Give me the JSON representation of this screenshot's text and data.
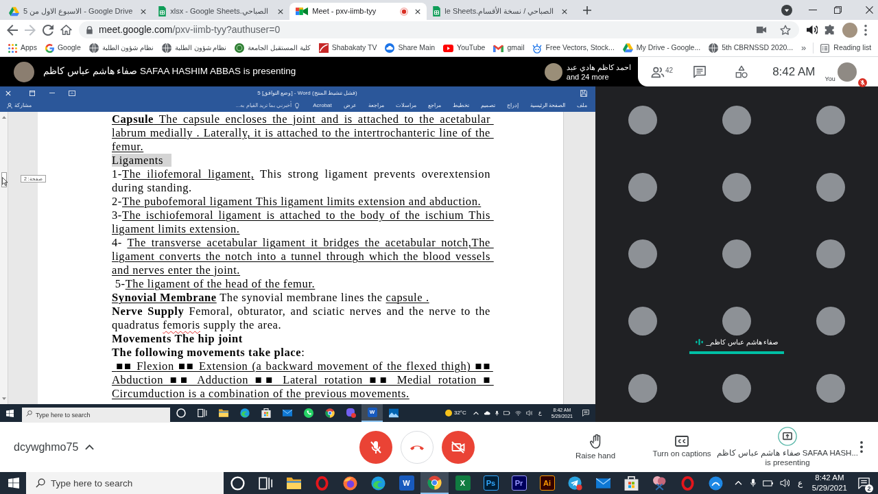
{
  "browser": {
    "tabs": [
      {
        "kind": "drive",
        "title": "5 الاسبوع الاول من - Google Drive",
        "selected": false,
        "recording": false
      },
      {
        "kind": "sheets",
        "title": "xlsx - Google Sheets.الصباحي",
        "selected": false,
        "recording": false
      },
      {
        "kind": "meet",
        "title": "Meet - pxv-iimb-tyy",
        "selected": true,
        "recording": true
      },
      {
        "kind": "sheets",
        "title": "le Sheets.الصباحي / نسخة الأقسام",
        "selected": false,
        "recording": false
      }
    ],
    "address": {
      "host": "meet.google.com",
      "path": "/pxv-iimb-tyy?authuser=0"
    },
    "bookmarks": [
      {
        "kind": "apps",
        "label": "Apps"
      },
      {
        "kind": "google",
        "label": "Google"
      },
      {
        "kind": "globe",
        "label": "نظام شؤون الطلبة"
      },
      {
        "kind": "globe",
        "label": "نظام شؤون الطلبة"
      },
      {
        "kind": "emblem",
        "label": "كلية المستقبل الجامعة"
      },
      {
        "kind": "tv",
        "label": "Shabakaty TV"
      },
      {
        "kind": "cloud",
        "label": "Share Main"
      },
      {
        "kind": "youtube",
        "label": "YouTube"
      },
      {
        "kind": "gmail",
        "label": "gmail"
      },
      {
        "kind": "robot",
        "label": "Free Vectors, Stock..."
      },
      {
        "kind": "drive",
        "label": "My Drive - Google..."
      },
      {
        "kind": "globe",
        "label": "5th CBRNSSD 2020..."
      }
    ],
    "more_bookmarks": "»",
    "reading_list": "Reading list"
  },
  "meet": {
    "presenter_banner": "صفاء هاشم عباس كاظم SAFAA HASHIM ABBAS is presenting",
    "others": {
      "name": "احمد كاظم هادي عبد",
      "more": "and 24 more"
    },
    "people_count": "42",
    "clock": "8:42 AM",
    "you": {
      "label": "You",
      "muted": true
    },
    "screen": {
      "title": "5 [وضع التوافق] - Word (فشل تنشيط المنتج)",
      "share": "مشاركة",
      "tell_me": {
        "placeholder": "أخبرني بما تريد القيام به..."
      },
      "ribbon_tabs": [
        "ملف",
        "الصفحة الرئيسية",
        "إدراج",
        "تصميم",
        "تخطيط",
        "مراجع",
        "مراسلات",
        "مراجعة",
        "عرض",
        "Acrobat"
      ],
      "page_tip": "صفحة: 2",
      "paragraphs": [
        {
          "runs": [
            {
              "text": "Capsule",
              "kind": "bold_underlined"
            },
            {
              "text": " The capsule encloses the joint and is attached to the acetabular labrum medially . Laterally, it is attached to the intertrochanteric line of the femur.",
              "kind": "underlined"
            }
          ]
        },
        {
          "runs": [
            {
              "text": "Ligaments",
              "kind": "highlighted"
            }
          ]
        },
        {
          "runs": [
            {
              "text": "1-",
              "kind": "plain"
            },
            {
              "text": "The iliofemoral ligament,",
              "kind": "underlined"
            },
            {
              "text": " This strong ligament prevents overextension during standing.",
              "kind": "plain"
            }
          ]
        },
        {
          "runs": [
            {
              "text": "2-",
              "kind": "plain"
            },
            {
              "text": "The pubofemoral ligament This ligament limits extension and abduction.",
              "kind": "underlined"
            }
          ]
        },
        {
          "runs": [
            {
              "text": "3-",
              "kind": "plain"
            },
            {
              "text": "The ischiofemoral ligament is attached to the body of the ischium This ligament limits extension.",
              "kind": "underlined"
            }
          ]
        },
        {
          "runs": [
            {
              "text": "4- ",
              "kind": "plain"
            },
            {
              "text": "The transverse acetabular ligament it bridges the acetabular notch,The ligament converts the notch into a tunnel through which the blood vessels and nerves enter the joint.",
              "kind": "underlined"
            }
          ]
        },
        {
          "runs": [
            {
              "text": " 5-",
              "kind": "plain"
            },
            {
              "text": "The ligament of the head of the femur.",
              "kind": "underlined"
            }
          ]
        },
        {
          "runs": [
            {
              "text": "Synovial Membrane",
              "kind": "bold_underlined"
            },
            {
              "text": " The synovial membrane lines the ",
              "kind": "plain"
            },
            {
              "text": "capsule .",
              "kind": "underlined"
            }
          ]
        },
        {
          "runs": [
            {
              "text": "Nerve Supply",
              "kind": "bold"
            },
            {
              "text": " Femoral, obturator, and sciatic nerves and the nerve to the quadratus ",
              "kind": "plain"
            },
            {
              "text": "femoris",
              "kind": "misspelled"
            },
            {
              "text": " supply the area.",
              "kind": "plain"
            }
          ]
        },
        {
          "runs": [
            {
              "text": "Movements The hip joint",
              "kind": "bold"
            }
          ]
        },
        {
          "runs": [
            {
              "text": "The following movements take place",
              "kind": "bold"
            },
            {
              "text": ":",
              "kind": "plain"
            }
          ]
        },
        {
          "runs": [
            {
              "text": " ■■ Flexion ■■ Extension (a backward movement of the flexed thigh) ■■ Abduction ■■ Adduction ■■ Lateral rotation ■■ Medial rotation ■ Circumduction is a combination of the previous movements.",
              "kind": "underlined"
            }
          ]
        }
      ],
      "taskbar": {
        "search_placeholder": "Type here to search",
        "apps": [
          {
            "kind": "cortana",
            "selected": false
          },
          {
            "kind": "taskview",
            "selected": false
          },
          {
            "kind": "explorer",
            "selected": false
          },
          {
            "kind": "edge",
            "selected": false
          },
          {
            "kind": "store",
            "selected": false
          },
          {
            "kind": "mail",
            "selected": false
          },
          {
            "kind": "whatsapp",
            "selected": false
          },
          {
            "kind": "chrome",
            "selected": false
          },
          {
            "kind": "viber",
            "selected": false
          },
          {
            "kind": "word",
            "label": "W",
            "selected": true
          },
          {
            "kind": "photos",
            "selected": false
          }
        ],
        "weather": "32°C",
        "language": "ع",
        "time": "8:42 AM",
        "date": "5/29/2021"
      }
    },
    "tiles": [
      {
        "speaking": false
      },
      {
        "speaking": false
      },
      {
        "speaking": false
      },
      {
        "speaking": false
      },
      {
        "speaking": false
      },
      {
        "speaking": false
      },
      {
        "speaking": false
      },
      {
        "speaking": false
      },
      {
        "speaking": false
      },
      {
        "speaking": false
      },
      {
        "name": "صفاء هاشم عباس كاظم_",
        "speaking": true
      },
      {
        "speaking": false
      },
      {
        "speaking": false
      },
      {
        "speaking": false
      },
      {
        "speaking": false
      }
    ],
    "meeting_code": "dcywghmo75",
    "controls": [
      {
        "kind": "mic",
        "on": false
      },
      {
        "kind": "hangup"
      },
      {
        "kind": "camera",
        "on": false
      }
    ],
    "actions": [
      {
        "kind": "raise_hand",
        "label": "Raise hand"
      },
      {
        "kind": "captions",
        "label": "Turn on captions"
      },
      {
        "kind": "presenting",
        "label": "صفاء هاشم عباس كاظم SAFAA HASH...",
        "sublabel": "is presenting"
      }
    ]
  },
  "taskbar": {
    "search_placeholder": "Type here to search",
    "apps": [
      {
        "kind": "cortana",
        "selected": false
      },
      {
        "kind": "taskview",
        "selected": false
      },
      {
        "kind": "explorer",
        "selected": false
      },
      {
        "kind": "opera",
        "selected": false
      },
      {
        "kind": "firefox",
        "selected": false
      },
      {
        "kind": "edge",
        "selected": false
      },
      {
        "kind": "word",
        "label": "W",
        "selected": false
      },
      {
        "kind": "chrome",
        "selected": true
      },
      {
        "kind": "excel",
        "label": "X",
        "selected": false
      },
      {
        "kind": "photoshop",
        "label": "Ps",
        "selected": false
      },
      {
        "kind": "premiere",
        "label": "Pr",
        "selected": false
      },
      {
        "kind": "illustrator",
        "label": "Ai",
        "selected": false
      },
      {
        "kind": "telegram",
        "selected": false
      },
      {
        "kind": "mail",
        "selected": false
      },
      {
        "kind": "store",
        "selected": false
      },
      {
        "kind": "snip",
        "selected": false
      },
      {
        "kind": "opera",
        "selected": false
      },
      {
        "kind": "messenger",
        "selected": false
      }
    ],
    "language": "ع",
    "time": "8:42 AM",
    "date": "5/29/2021",
    "notification_count": "2"
  }
}
